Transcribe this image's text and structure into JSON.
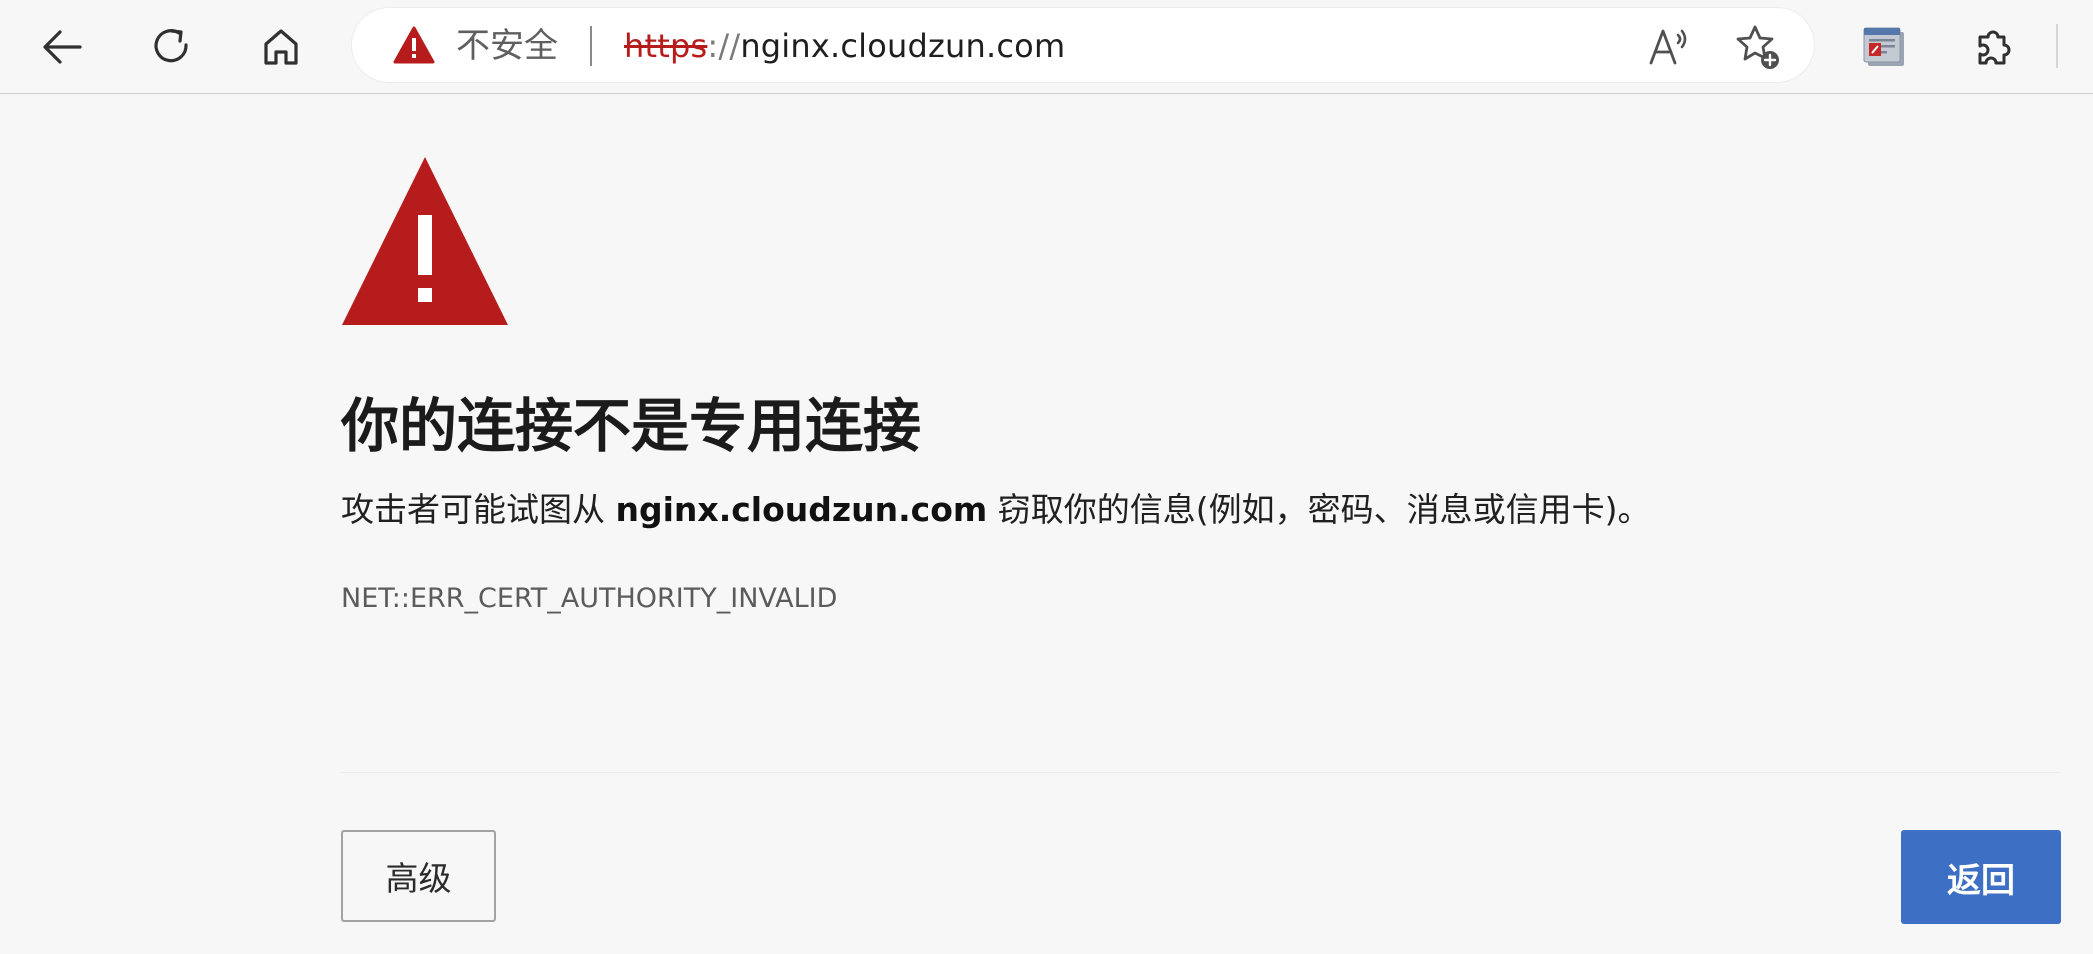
{
  "toolbar": {
    "back_icon": "arrow-left-icon",
    "refresh_icon": "refresh-icon",
    "home_icon": "home-icon",
    "read_aloud_icon": "read-aloud-icon",
    "favorites_icon": "add-favorite-icon",
    "extension_app_icon": "extension-app-icon",
    "extensions_icon": "puzzle-piece-icon"
  },
  "addressbar": {
    "security_icon": "warning-triangle-icon",
    "security_label": "不安全",
    "url_scheme": "https",
    "url_separator": "://",
    "url_host": "nginx.cloudzun.com"
  },
  "page": {
    "warning_icon": "warning-triangle-icon",
    "heading": "你的连接不是专用连接",
    "message_prefix": "攻击者可能试图从 ",
    "message_host": "nginx.cloudzun.com",
    "message_suffix": " 窃取你的信息(例如，密码、消息或信用卡)。",
    "error_code": "NET::ERR_CERT_AUTHORITY_INVALID",
    "advanced_button": "高级",
    "back_button": "返回"
  },
  "colors": {
    "warning_red": "#b71c1c",
    "primary_button": "#3d6fc4",
    "page_background": "#f7f7f7"
  }
}
